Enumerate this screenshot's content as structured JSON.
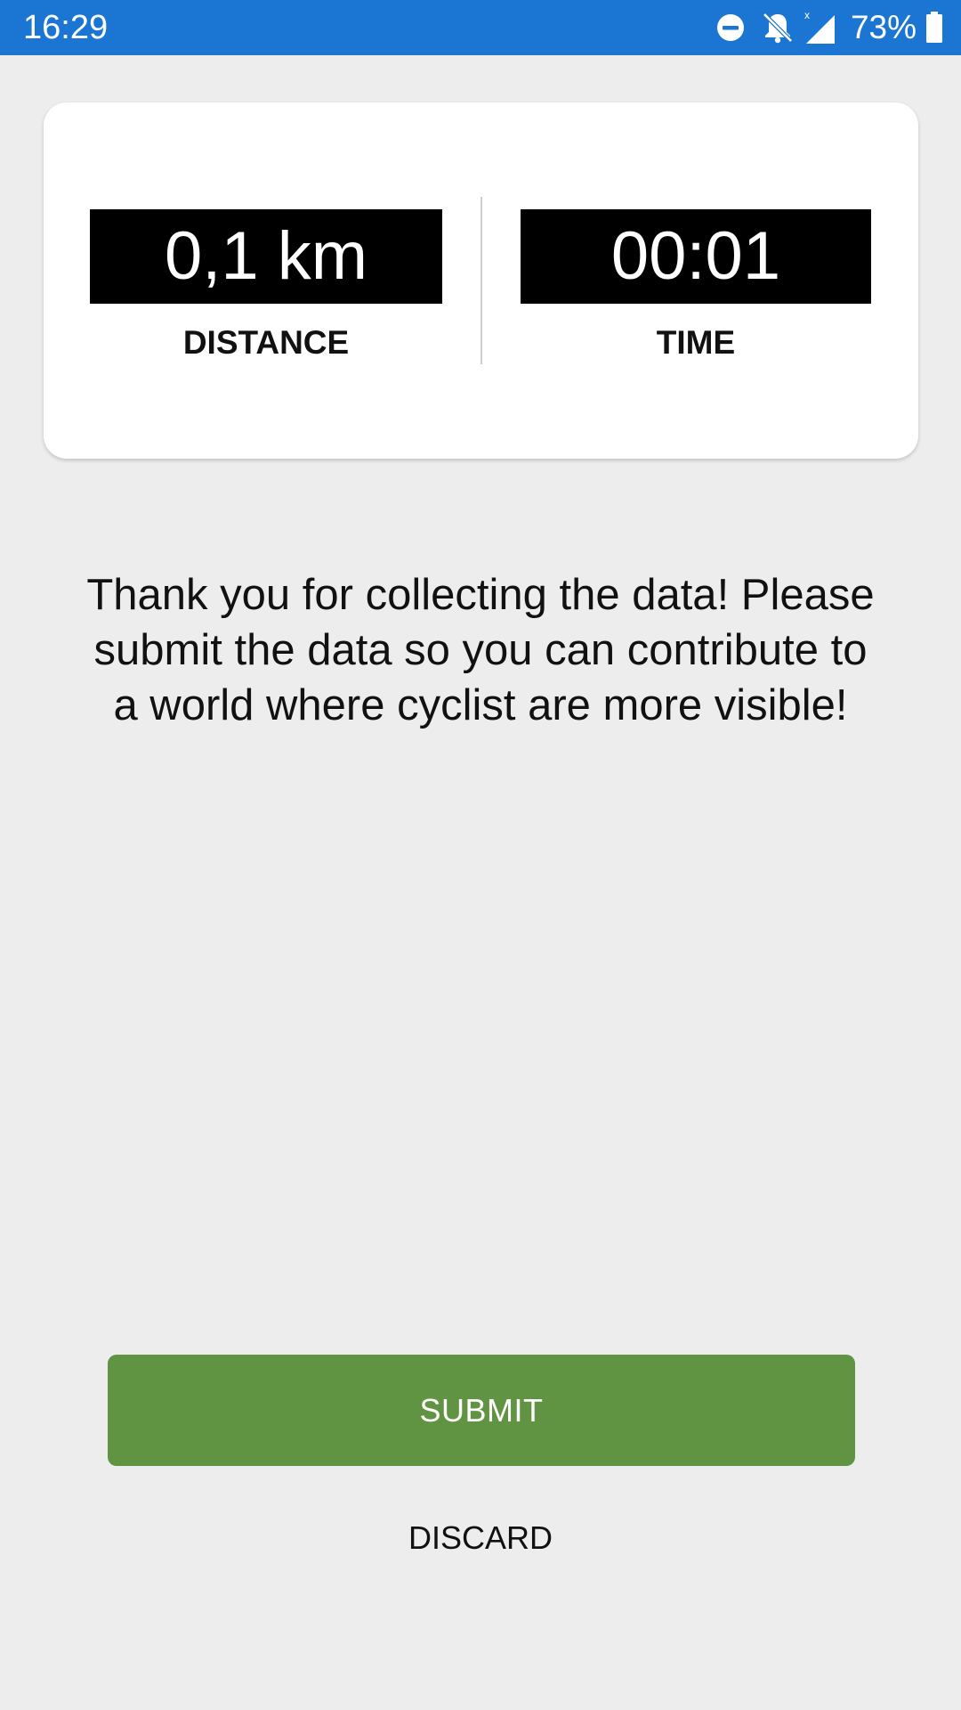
{
  "status_bar": {
    "time": "16:29",
    "battery_percent": "73%",
    "icons": [
      "do-not-disturb-icon",
      "notifications-off-icon",
      "cellular-signal-icon",
      "battery-icon"
    ],
    "color": "#1b76d3"
  },
  "stats": {
    "distance": {
      "value": "0,1 km",
      "label": "DISTANCE"
    },
    "time": {
      "value": "00:01",
      "label": "TIME"
    }
  },
  "message": "Thank you for collecting the data! Please submit the data so you can contribute to a world where cyclist are more visible!",
  "actions": {
    "submit_label": "SUBMIT",
    "submit_color": "#609443",
    "discard_label": "DISCARD"
  }
}
